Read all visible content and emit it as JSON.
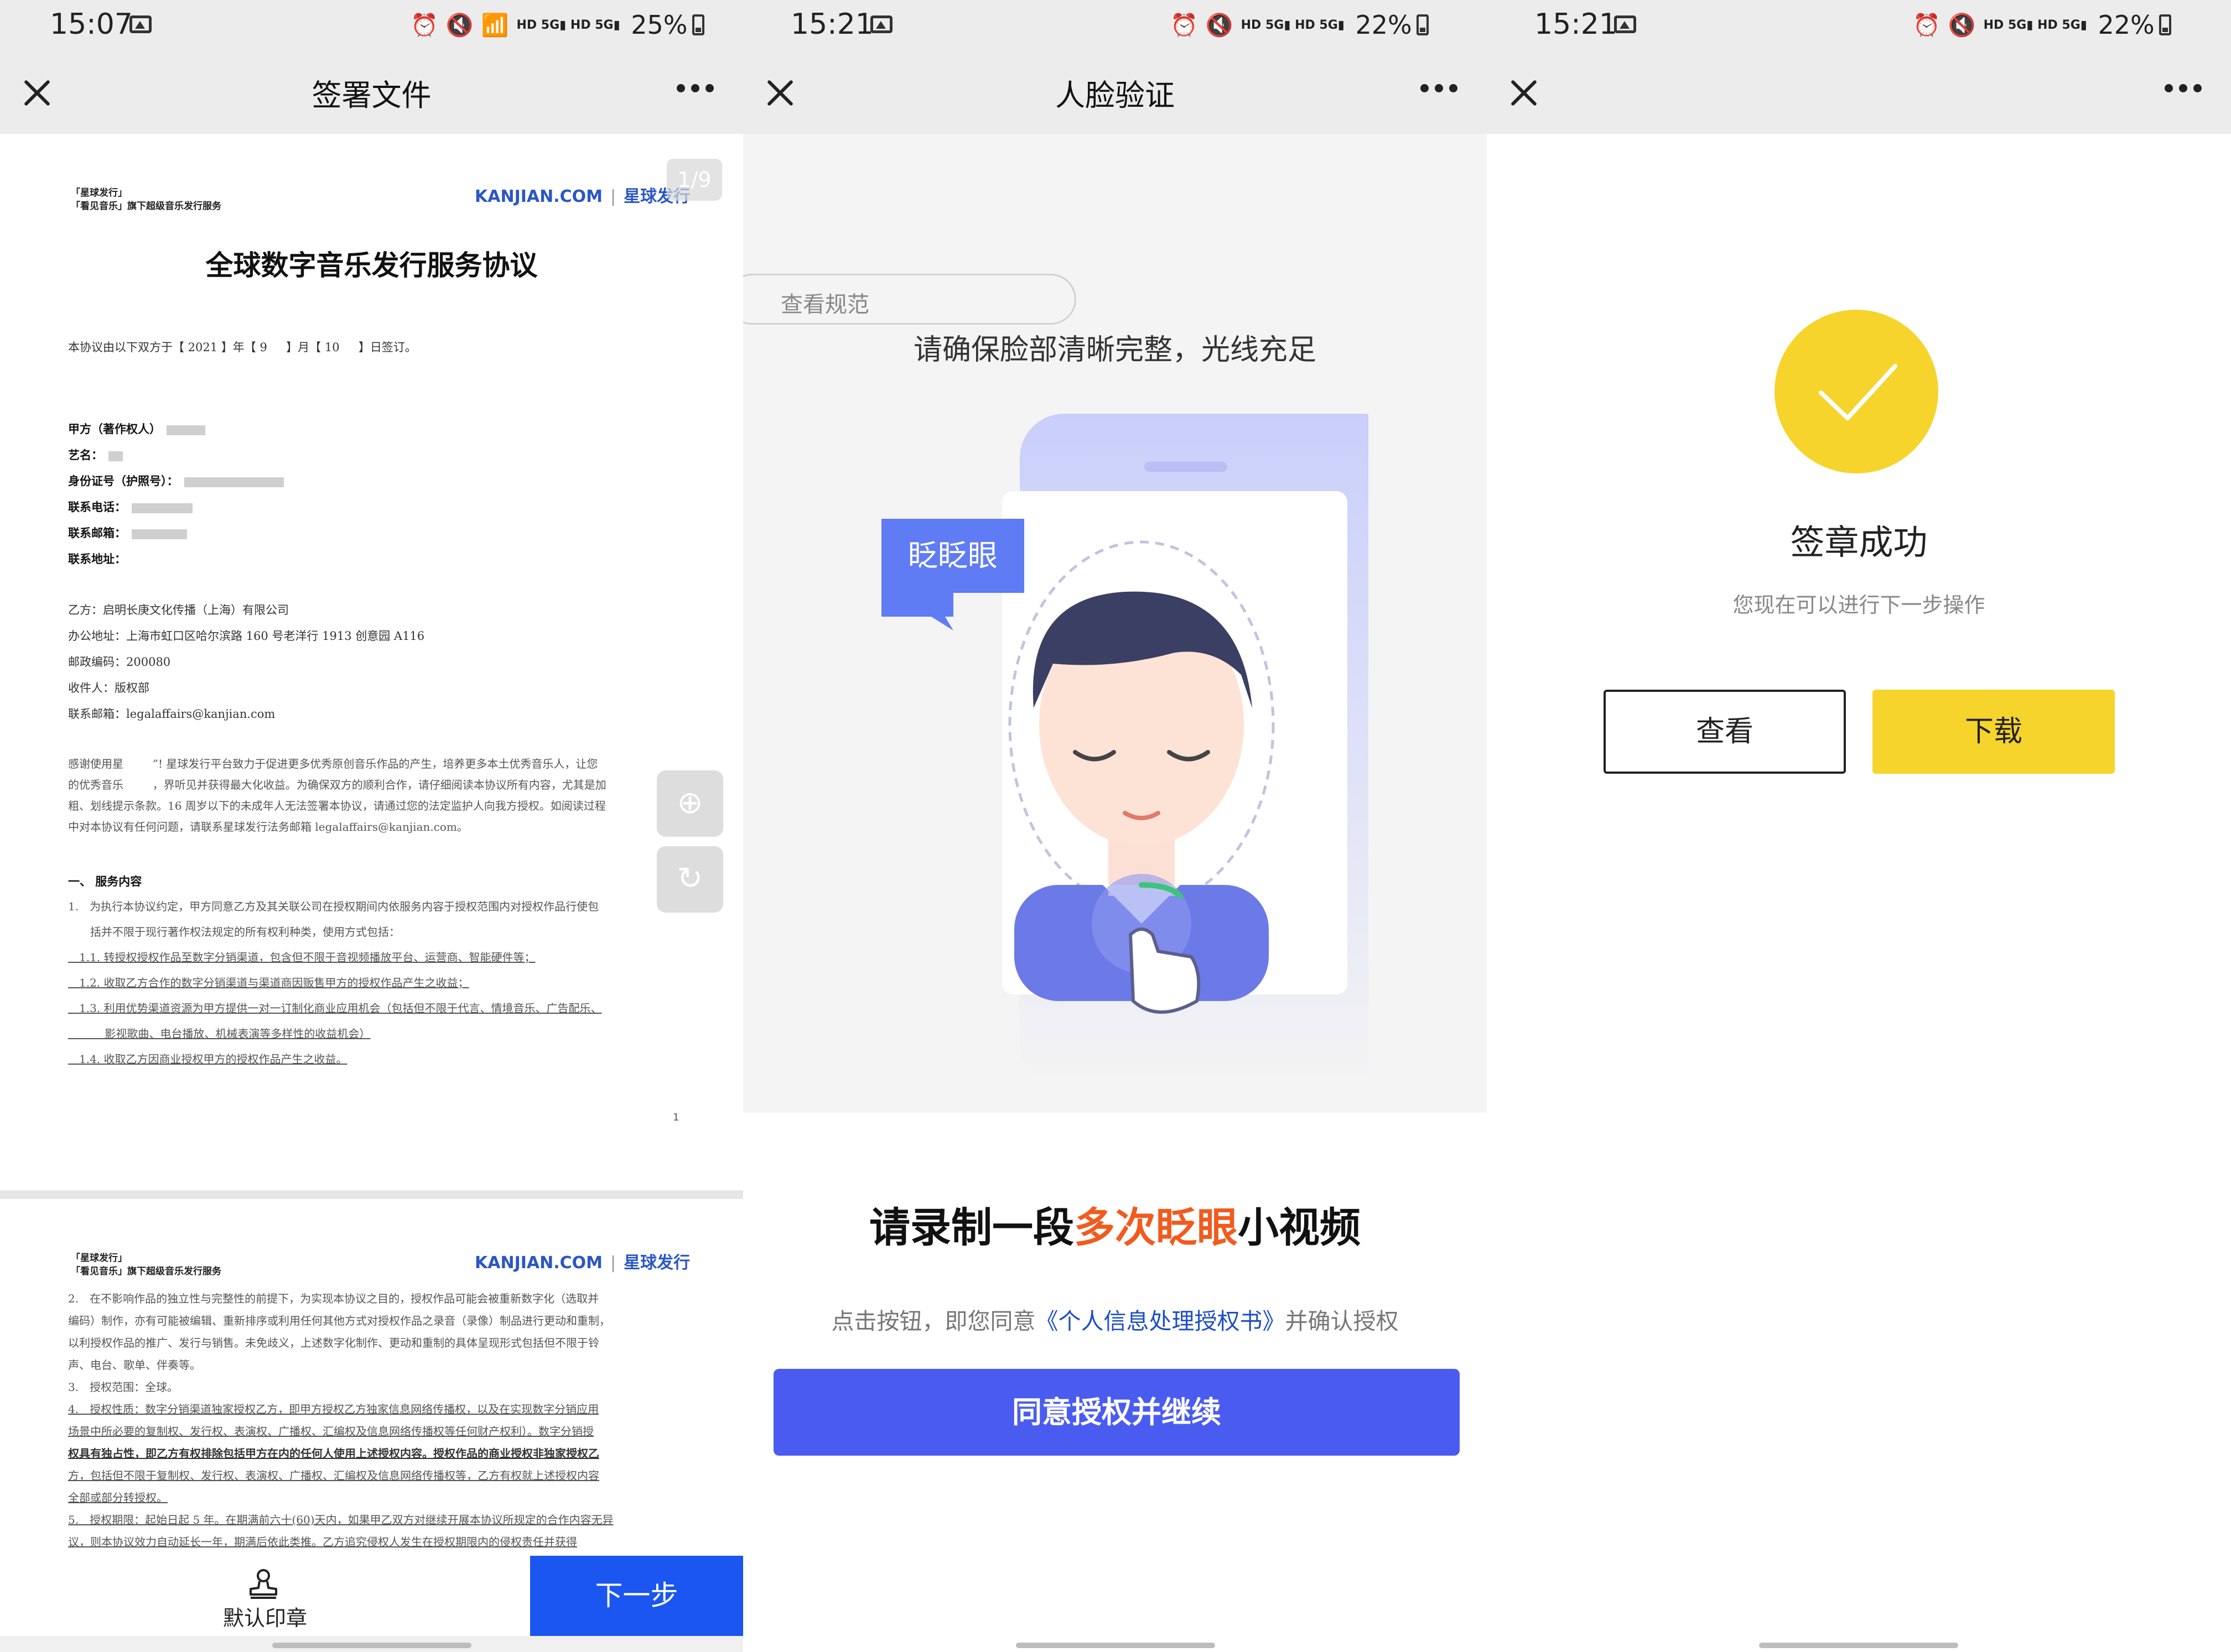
{
  "screens": [
    {
      "status": {
        "time": "15:07",
        "battery": "25%"
      },
      "nav": {
        "title": "签署文件"
      },
      "doc": {
        "page_indicator": "1/9",
        "header_left": [
          "「星球发行」",
          "「看见音乐」旗下超级音乐发行服务"
        ],
        "brand_kanjian": "KANJIAN.COM",
        "brand_xingqiu": "星球发行",
        "title": "全球数字音乐发行服务协议",
        "date_line": "本协议由以下双方于【 2021 】年【 9 　 】月【 10 　 】日签订。",
        "party_a": [
          "甲方（著作权人）",
          "艺名：",
          "身份证号（护照号）：",
          "联系电话：",
          "联系邮箱：",
          "联系地址："
        ],
        "party_b": [
          "乙方：启明长庚文化传播（上海）有限公司",
          "办公地址：上海市虹口区哈尔滨路 160 号老洋行 1913 创意园 A116",
          "邮政编码：200080",
          "收件人：版权部",
          "联系邮箱：legalaffairs@kanjian.com"
        ],
        "intro": [
          "感谢使用星 　　 ”! 星球发行平台致力于促进更多优秀原创音乐作品的产生，培养更多本土优秀音乐人，让您",
          "的优秀音乐 　　 ，界听见并获得最大化收益。为确保双方的顺利合作，请仔细阅读本协议所有内容，尤其是加",
          "粗、划线提示条款。16 周岁以下的未成年人无法签署本协议，请通过您的法定监护人向我方授权。如阅读过程",
          "中对本协议有任何问题，请联系星球发行法务邮箱 legalaffairs@kanjian.com。"
        ],
        "section_title": "一、 服务内容",
        "section_items": [
          "1.　为执行本协议约定，甲方同意乙方及其关联公司在授权期间内依服务内容于授权范围内对授权作品行使包",
          "　　括并不限于现行著作权法规定的所有权利种类，使用方式包括：",
          "　1.1. 转授权授权作品至数字分销渠道，包含但不限于音视频播放平台、运营商、智能硬件等；",
          "　1.2. 收取乙方合作的数字分销渠道与渠道商因贩售甲方的授权作品产生之收益；",
          "　1.3. 利用优势渠道资源为甲方提供一对一订制化商业应用机会（包括但不限于代言、情境音乐、广告配乐、",
          "　　　 影视歌曲、电台播放、机械表演等多样性的收益机会）",
          "　1.4. 收取乙方因商业授权甲方的授权作品产生之收益。"
        ],
        "page_footer_number": "1",
        "page2_lines": [
          "2.　在不影响作品的独立性与完整性的前提下，为实现本协议之目的，授权作品可能会被重新数字化（选取并",
          "编码）制作，亦有可能被编辑、重新排序或利用任何其他方式对授权作品之录音（录像）制品进行更动和重制，",
          "以利授权作品的推广、发行与销售。未免歧义，上述数字化制作、更动和重制的具体呈现形式包括但不限于铃",
          "声、电台、歌单、伴奏等。",
          "3.　授权范围：全球。",
          "4.　授权性质：数字分销渠道独家授权乙方，即甲方授权乙方独家信息网络传播权，以及在实现数字分销应用",
          "场景中所必要的复制权、发行权、表演权、广播权、汇编权及信息网络传播权等任何财产权利）。数字分销授",
          "权具有独占性，即乙方有权排除包括甲方在内的任何人使用上述授权内容。授权作品的商业授权非独家授权乙",
          "方，包括但不限于复制权、发行权、表演权、广播权、汇编权及信息网络传播权等，乙方有权就上述授权内容",
          "全部或部分转授权。",
          "5.　授权期限：起始日起 5 年。在期满前六十(60)天内，如果甲乙双方对继续开展本协议所规定的合作内容无异",
          "议，则本协议效力自动延长一年，期满后依此类推。乙方追究侵权人发生在授权期限内的侵权责任并获得"
        ]
      },
      "bottom": {
        "stamp_label": "默认印章",
        "next_label": "下一步"
      }
    },
    {
      "status": {
        "time": "15:21",
        "battery": "22%"
      },
      "nav": {
        "title": "人脸验证"
      },
      "spec_button": "查看规范",
      "hint": "请确保脸部清晰完整，光线充足",
      "bubble": "眨眨眼",
      "headline_pre": "请录制一段",
      "headline_highlight": "多次眨眼",
      "headline_post": "小视频",
      "consent_pre": "点击按钮，即您同意",
      "consent_link": "《个人信息处理授权书》",
      "consent_post": "并确认授权",
      "agree_button": "同意授权并继续"
    },
    {
      "status": {
        "time": "15:21",
        "battery": "22%"
      },
      "nav": {
        "title": ""
      },
      "success_title": "签章成功",
      "success_subtitle": "您现在可以进行下一步操作",
      "view_button": "查看",
      "download_button": "下载"
    }
  ],
  "colors": {
    "primary_blue": "#1a56ef",
    "button_purple_blue": "#4a5cf0",
    "highlight_orange": "#f25a1e",
    "success_yellow": "#f6d42c",
    "link_blue": "#1d4fc4"
  },
  "icons": [
    "close-icon",
    "more-icon",
    "gallery-icon",
    "alarm-icon",
    "mute-icon",
    "wifi-icon",
    "signal-icon",
    "battery-icon",
    "zoom-in-icon",
    "rotate-icon",
    "stamp-icon",
    "check-icon"
  ]
}
